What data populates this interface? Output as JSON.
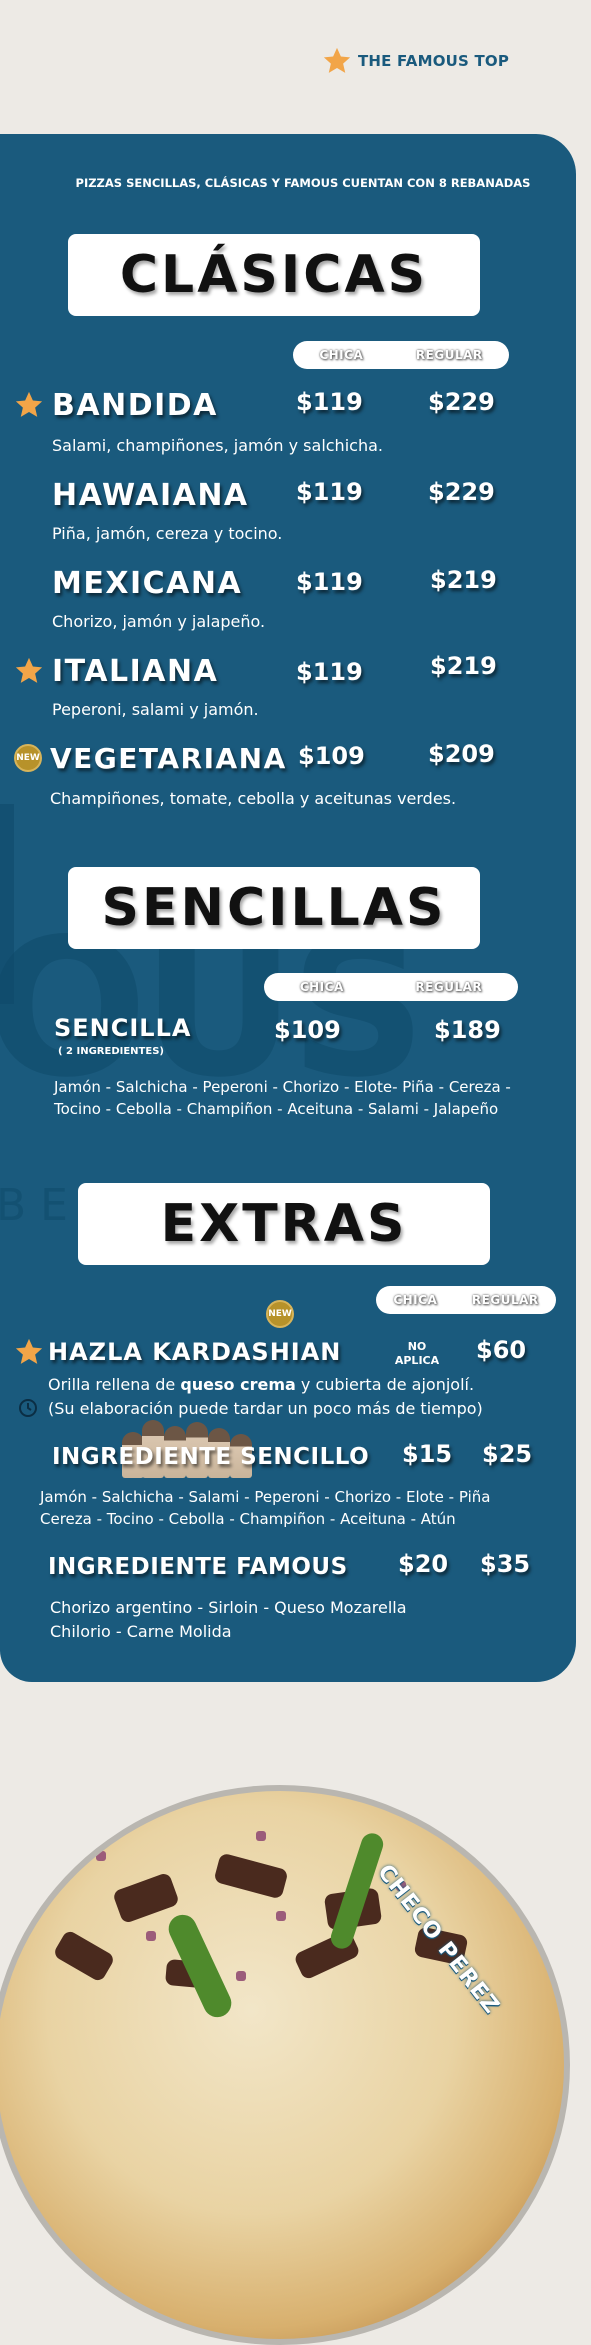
{
  "brand": {
    "name": "THE FAMOUS TOP",
    "icon": "star-icon",
    "color": "#1A5A7D"
  },
  "colors": {
    "panel": "#1A5A7D",
    "background": "#EDEAE5",
    "star": "#F2A548",
    "badge": "#B7922A"
  },
  "note": "PIZZAS SENCILLAS, CLÁSICAS Y FAMOUS CUENTAN CON 8 REBANADAS",
  "watermark": {
    "big": "OUS",
    "small": "BEER"
  },
  "clasicas": {
    "title": "CLÁSICAS",
    "col_chica": "CHICA",
    "col_regular": "REGULAR",
    "items": [
      {
        "name": "BANDIDA",
        "chica": "$119",
        "regular": "$229",
        "desc": "Salami, champiñones, jamón y salchicha.",
        "badge": "star"
      },
      {
        "name": "HAWAIANA",
        "chica": "$119",
        "regular": "$229",
        "desc": "Piña, jamón, cereza y tocino.",
        "badge": ""
      },
      {
        "name": "MEXICANA",
        "chica": "$119",
        "regular": "$219",
        "desc": "Chorizo, jamón y jalapeño.",
        "badge": ""
      },
      {
        "name": "ITALIANA",
        "chica": "$119",
        "regular": "$219",
        "desc": "Peperoni, salami y jamón.",
        "badge": "star"
      },
      {
        "name": "VEGETARIANA",
        "chica": "$109",
        "regular": "$209",
        "desc": "Champiñones, tomate, cebolla y aceitunas verdes.",
        "badge": "NEW"
      }
    ]
  },
  "sencillas": {
    "title": "SENCILLAS",
    "col_chica": "CHICA",
    "col_regular": "REGULAR",
    "item": {
      "name": "SENCILLA",
      "sub": "( 2 INGREDIENTES)",
      "chica": "$109",
      "regular": "$189",
      "desc_line1": "Jamón - Salchicha  - Peperoni - Chorizo - Elote- Piña - Cereza -",
      "desc_line2": "Tocino - Cebolla - Champiñon - Aceituna - Salami - Jalapeño"
    }
  },
  "extras": {
    "title": "EXTRAS",
    "col_chica": "CHICA",
    "col_regular": "REGULAR",
    "kardashian": {
      "name": "HAZLA KARDASHIAN",
      "chica_line1": "NO",
      "chica_line2": "APLICA",
      "regular": "$60",
      "badge": "NEW",
      "desc_pre": "Orilla rellena de ",
      "desc_bold": "queso crema",
      "desc_post": " y cubierta de ajonjolí.",
      "note": "(Su elaboración puede tardar un poco más de tiempo)"
    },
    "sencillo": {
      "name": "INGREDIENTE SENCILLO",
      "chica": "$15",
      "regular": "$25",
      "desc_line1": "Jamón - Salchicha -  Salami - Peperoni - Chorizo - Elote - Piña",
      "desc_line2": "Cereza - Tocino - Cebolla - Champiñon - Aceituna - Atún"
    },
    "famous": {
      "name": "INGREDIENTE FAMOUS",
      "chica": "$20",
      "regular": "$35",
      "desc_line1": "Chorizo argentino - Sirloin  - Queso Mozarella",
      "desc_line2": "Chilorio - Carne Molida"
    }
  },
  "pizza_label": "CHECO PEREZ"
}
